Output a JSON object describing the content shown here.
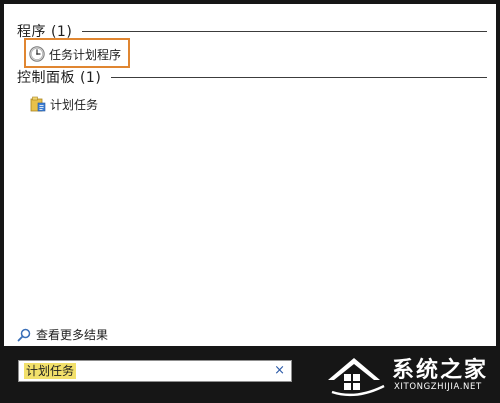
{
  "results": {
    "groups": [
      {
        "header": "程序 (1)",
        "items": [
          {
            "label": "任务计划程序",
            "icon": "clock-icon",
            "highlighted": true
          }
        ]
      },
      {
        "header": "控制面板 (1)",
        "items": [
          {
            "label": "计划任务",
            "icon": "folder-tasks-icon",
            "highlighted": false
          }
        ]
      }
    ],
    "see_more_label": "查看更多结果"
  },
  "search": {
    "value": "计划任务",
    "clear_glyph": "×"
  },
  "watermark": {
    "name": "系统之家",
    "domain": "XITONGZHIJIA.NET"
  },
  "colors": {
    "highlight_border": "#e08631",
    "query_highlight": "#f2e06b",
    "background": "#161616"
  }
}
